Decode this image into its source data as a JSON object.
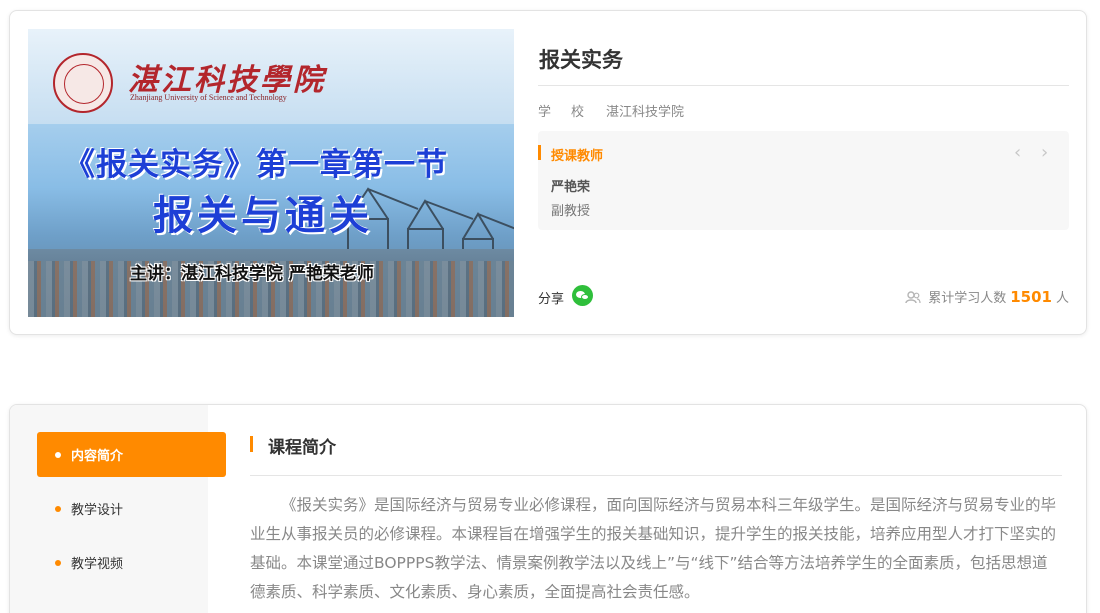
{
  "cover": {
    "school_name": "湛江科技學院",
    "school_name_en": "Zhanjiang University of Science and Technology",
    "heading_line1": "《报关实务》第一章第一节",
    "heading_line2": "报关与通关",
    "presenter": "主讲：湛江科技学院  严艳荣老师"
  },
  "course": {
    "title": "报关实务",
    "school_label": "学校",
    "school_value": "湛江科技学院"
  },
  "teachers": {
    "heading": "授课教师",
    "prev_icon": "‹",
    "next_icon": "›",
    "name": "严艳荣",
    "rank": "副教授"
  },
  "share": {
    "label": "分享",
    "icon": "wechat-icon"
  },
  "stats": {
    "prefix": "累计学习人数",
    "count": "1501",
    "suffix": "人"
  },
  "sidebar": {
    "items": [
      {
        "label": "内容简介",
        "active": true
      },
      {
        "label": "教学设计",
        "active": false
      },
      {
        "label": "教学视频",
        "active": false
      }
    ]
  },
  "intro": {
    "title": "课程简介",
    "text": "《报关实务》是国际经济与贸易专业必修课程，面向国际经济与贸易本科三年级学生。是国际经济与贸易专业的毕业生从事报关员的必修课程。本课程旨在增强学生的报关基础知识，提升学生的报关技能，培养应用型人才打下坚实的基础。本课堂通过BOPPPS教学法、情景案例教学法以及线上”与“线下”结合等方法培养学生的全面素质，包括思想道德素质、科学素质、文化素质、身心素质，全面提高社会责任感。"
  },
  "colors": {
    "accent": "#ff8a00",
    "wechat": "#2fbf3b"
  }
}
